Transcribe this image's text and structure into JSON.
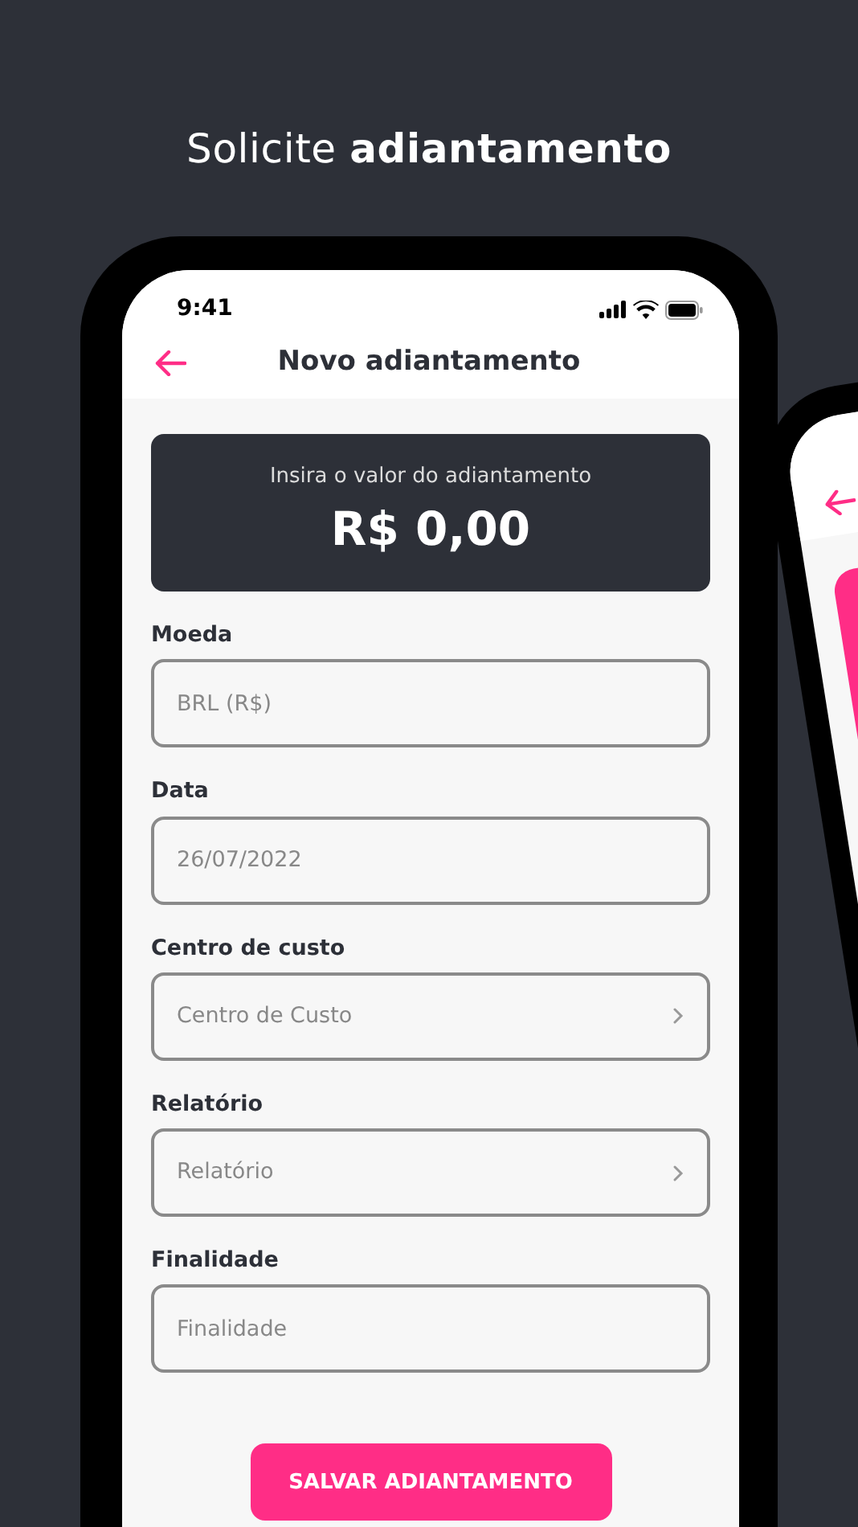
{
  "headline": "Solicite **adiantamento**",
  "phone": {
    "status_time": "9:41",
    "title": "Novo adiantamento",
    "amount_card": {
      "label": "Insira o valor do adiantamento",
      "amount": "R$ 0,00"
    },
    "fields": [
      {
        "label": "Moeda",
        "kind": "text",
        "value": "BRL (R$)"
      },
      {
        "label": "Data",
        "kind": "text",
        "value": "26/07/2022"
      },
      {
        "label": "Centro de custo",
        "kind": "select",
        "placeholder": "Centro de Custo"
      },
      {
        "label": "Relatório",
        "kind": "select",
        "placeholder": "Relatório"
      },
      {
        "label": "Finalidade",
        "kind": "text",
        "placeholder": "Finalidade"
      }
    ],
    "button": "SALVAR ADIANTAMENTO"
  }
}
